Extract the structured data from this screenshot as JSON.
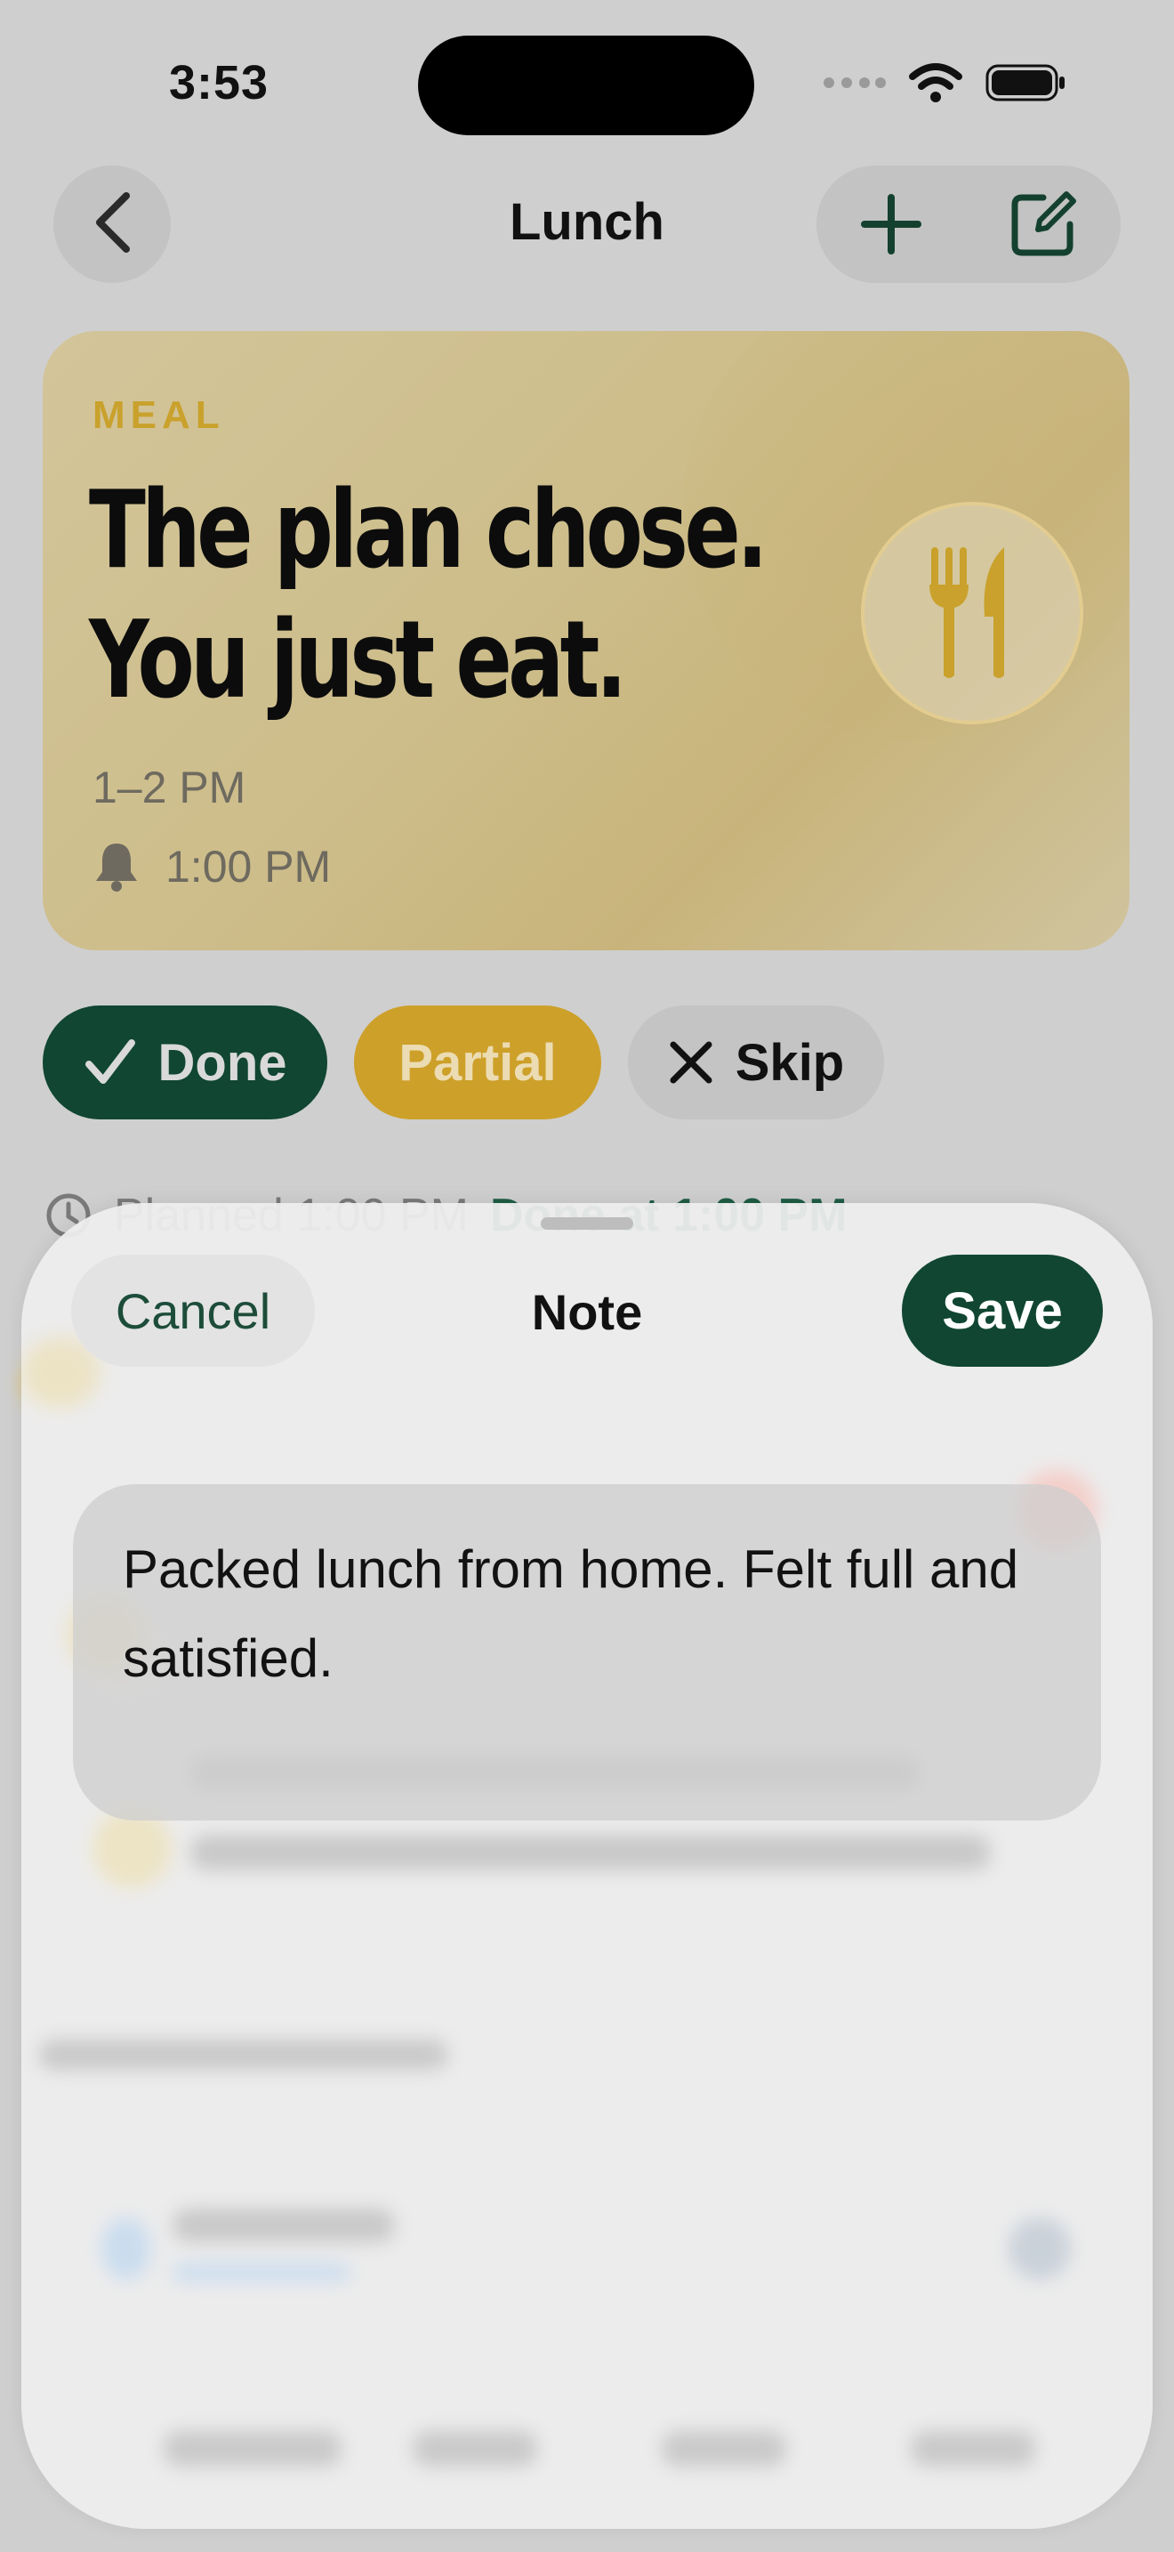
{
  "status_bar": {
    "time": "3:53"
  },
  "nav": {
    "title": "Lunch",
    "back_icon": "chevron-left-icon",
    "add_icon": "plus-icon",
    "edit_icon": "compose-icon"
  },
  "meal_card": {
    "kicker": "MEAL",
    "headline_line1": "The plan chose.",
    "headline_line2": "You just eat.",
    "time_window": "1–2 PM",
    "reminder_time": "1:00 PM",
    "reminder_icon": "bell-icon",
    "meal_icon": "fork-knife-icon"
  },
  "status_chips": {
    "done_label": "Done",
    "partial_label": "Partial",
    "skip_label": "Skip"
  },
  "peek": {
    "planned": "Planned 1:00 PM",
    "done_at": "Done at 1:00 PM"
  },
  "sheet": {
    "cancel_label": "Cancel",
    "title": "Note",
    "save_label": "Save",
    "note_text": "Packed lunch from home. Felt full and satisfied."
  },
  "colors": {
    "accent_green": "#104632",
    "accent_gold": "#cda02a"
  }
}
